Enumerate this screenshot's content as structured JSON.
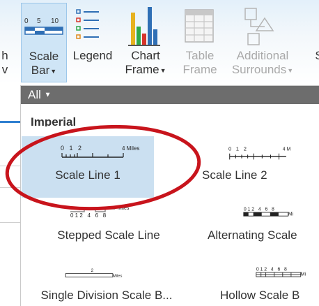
{
  "ribbon": {
    "edge_label": "h",
    "edge_sub": "v",
    "scale_bar": {
      "label_line1": "Scale",
      "label_line2": "Bar",
      "icon_ticks": "0 5 10"
    },
    "legend": {
      "label": "Legend"
    },
    "chart_frame": {
      "label_line1": "Chart",
      "label_line2": "Frame"
    },
    "table_frame": {
      "label_line1": "Table",
      "label_line2": "Frame"
    },
    "additional_surrounds": {
      "label_line1": "Additional",
      "label_line2": "Surrounds"
    },
    "next_label": "S"
  },
  "gallery": {
    "filter_label": "All",
    "section": "Imperial",
    "items": [
      {
        "name": "Scale Line 1",
        "preview_ticks": "0   1   2",
        "preview_unit": "4 Miles",
        "selected": true
      },
      {
        "name": "Scale Line 2",
        "preview_ticks": "0   1   2",
        "preview_unit": "4 M"
      },
      {
        "name": "Stepped Scale Line",
        "preview_ticks": "0 1 2   4   6   8",
        "preview_unit": "Miles"
      },
      {
        "name": "Alternating Scale",
        "preview_ticks": "0 1 2   4   6   8",
        "preview_unit": "Mi"
      },
      {
        "name": "Single Division Scale B...",
        "preview_ticks": "2",
        "preview_unit": "Miles"
      },
      {
        "name": "Hollow Scale B",
        "preview_ticks": "0 1 2   4   6   8",
        "preview_unit": "Mi"
      }
    ]
  },
  "colors": {
    "selection": "#cbe0f1",
    "highlight_ring": "#c8141c",
    "filter_bar": "#6d6d6d"
  }
}
